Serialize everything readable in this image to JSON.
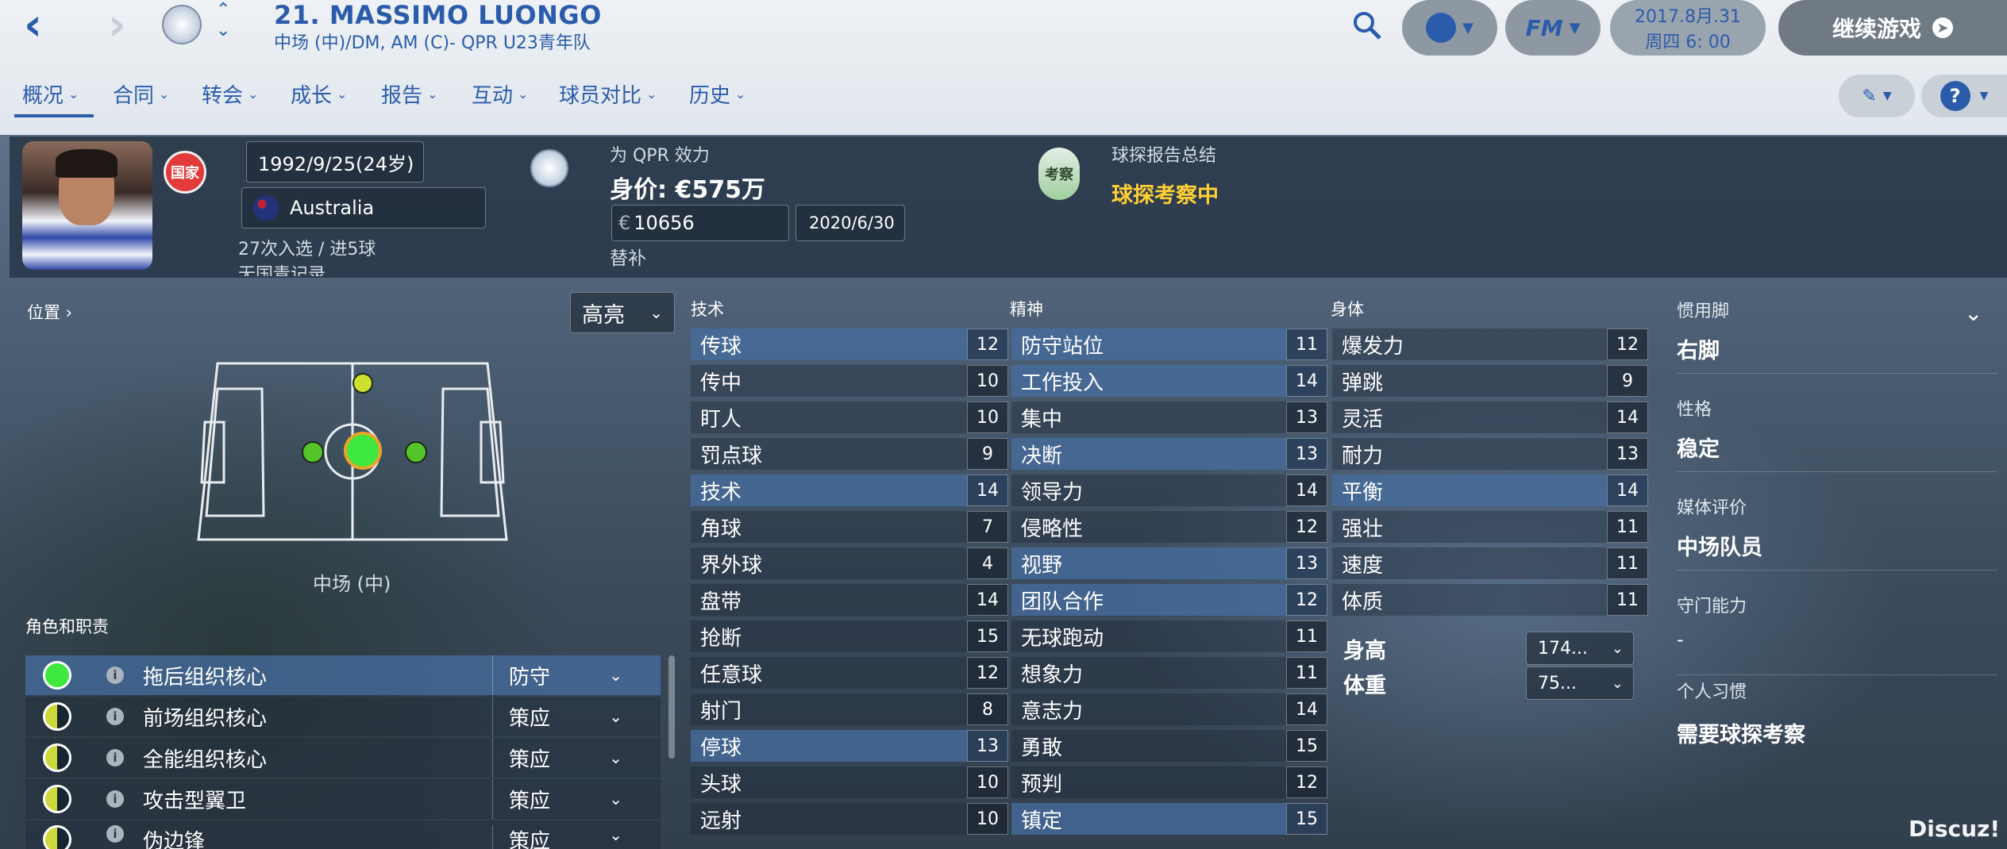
{
  "header": {
    "player_name": "21. MASSIMO LUONGO",
    "player_sub": "中场 (中)/DM, AM (C)- QPR U23青年队",
    "date": "2017.8月.31",
    "time": "周四 6: 00",
    "continue_label": "继续游戏",
    "fm_label": "FM"
  },
  "menu": [
    {
      "label": "概况"
    },
    {
      "label": "合同"
    },
    {
      "label": "转会"
    },
    {
      "label": "成长"
    },
    {
      "label": "报告"
    },
    {
      "label": "互动"
    },
    {
      "label": "球员对比"
    },
    {
      "label": "历史"
    }
  ],
  "info": {
    "birth": "1992/9/25(24岁)",
    "nation_badge": "国家",
    "nation": "Australia",
    "caps": "27次入选 / 进5球",
    "caps_extra": "无国青记录",
    "club_label": "为 QPR 效力",
    "value": "身价: €575万",
    "wage": "10656",
    "wage_currency": "€",
    "contract_end": "2020/6/30",
    "squad_status": "替补",
    "scout_badge": "考察",
    "scout_title": "球探报告总结",
    "scout_status": "球探考察中"
  },
  "position": {
    "label": "位置",
    "highlight": "高亮",
    "caption": "中场 (中)",
    "roles_title": "角色和职责",
    "roles": [
      {
        "name": "拖后组织核心",
        "duty": "防守",
        "color": "#3ee83e",
        "half": false
      },
      {
        "name": "前场组织核心",
        "duty": "策应",
        "color": "#cdd83a",
        "half": true
      },
      {
        "name": "全能组织核心",
        "duty": "策应",
        "color": "#cdd83a",
        "half": true
      },
      {
        "name": "攻击型翼卫",
        "duty": "策应",
        "color": "#cdd83a",
        "half": true
      },
      {
        "name": "伪边锋",
        "duty": "策应",
        "color": "#cdd83a",
        "half": true
      }
    ]
  },
  "technical": {
    "title": "技术",
    "items": [
      {
        "name": "传球",
        "value": 12,
        "hl": true
      },
      {
        "name": "传中",
        "value": 10,
        "hl": false
      },
      {
        "name": "盯人",
        "value": 10,
        "hl": false
      },
      {
        "name": "罚点球",
        "value": 9,
        "hl": false
      },
      {
        "name": "技术",
        "value": 14,
        "hl": true
      },
      {
        "name": "角球",
        "value": 7,
        "hl": false
      },
      {
        "name": "界外球",
        "value": 4,
        "hl": false
      },
      {
        "name": "盘带",
        "value": 14,
        "hl": false
      },
      {
        "name": "抢断",
        "value": 15,
        "hl": false
      },
      {
        "name": "任意球",
        "value": 12,
        "hl": false
      },
      {
        "name": "射门",
        "value": 8,
        "hl": false
      },
      {
        "name": "停球",
        "value": 13,
        "hl": true
      },
      {
        "name": "头球",
        "value": 10,
        "hl": false
      },
      {
        "name": "远射",
        "value": 10,
        "hl": false
      }
    ]
  },
  "mental": {
    "title": "精神",
    "items": [
      {
        "name": "防守站位",
        "value": 11,
        "hl": true
      },
      {
        "name": "工作投入",
        "value": 14,
        "hl": true
      },
      {
        "name": "集中",
        "value": 13,
        "hl": false
      },
      {
        "name": "决断",
        "value": 13,
        "hl": true
      },
      {
        "name": "领导力",
        "value": 14,
        "hl": false
      },
      {
        "name": "侵略性",
        "value": 12,
        "hl": false
      },
      {
        "name": "视野",
        "value": 13,
        "hl": true
      },
      {
        "name": "团队合作",
        "value": 12,
        "hl": true
      },
      {
        "name": "无球跑动",
        "value": 11,
        "hl": false
      },
      {
        "name": "想象力",
        "value": 11,
        "hl": false
      },
      {
        "name": "意志力",
        "value": 14,
        "hl": false
      },
      {
        "name": "勇敢",
        "value": 15,
        "hl": false
      },
      {
        "name": "预判",
        "value": 12,
        "hl": false
      },
      {
        "name": "镇定",
        "value": 15,
        "hl": true
      }
    ]
  },
  "physical": {
    "title": "身体",
    "items": [
      {
        "name": "爆发力",
        "value": 12,
        "hl": false
      },
      {
        "name": "弹跳",
        "value": 9,
        "hl": false
      },
      {
        "name": "灵活",
        "value": 14,
        "hl": false
      },
      {
        "name": "耐力",
        "value": 13,
        "hl": false
      },
      {
        "name": "平衡",
        "value": 14,
        "hl": true
      },
      {
        "name": "强壮",
        "value": 11,
        "hl": false
      },
      {
        "name": "速度",
        "value": 11,
        "hl": false
      },
      {
        "name": "体质",
        "value": 11,
        "hl": false
      }
    ],
    "height_label": "身高",
    "height": "174...",
    "weight_label": "体重",
    "weight": "75..."
  },
  "profile": [
    {
      "label": "惯用脚",
      "value": "右脚"
    },
    {
      "label": "性格",
      "value": "稳定"
    },
    {
      "label": "媒体评价",
      "value": "中场队员"
    },
    {
      "label": "守门能力",
      "value": "-"
    },
    {
      "label": "个人习惯",
      "value": "需要球探考察"
    }
  ],
  "watermark": "Discuz!",
  "colors": {
    "accent": "#2b5cab",
    "scout_yellow": "#ffcf33",
    "role_green": "#3ee83e",
    "role_yellow": "#cdd83a"
  }
}
